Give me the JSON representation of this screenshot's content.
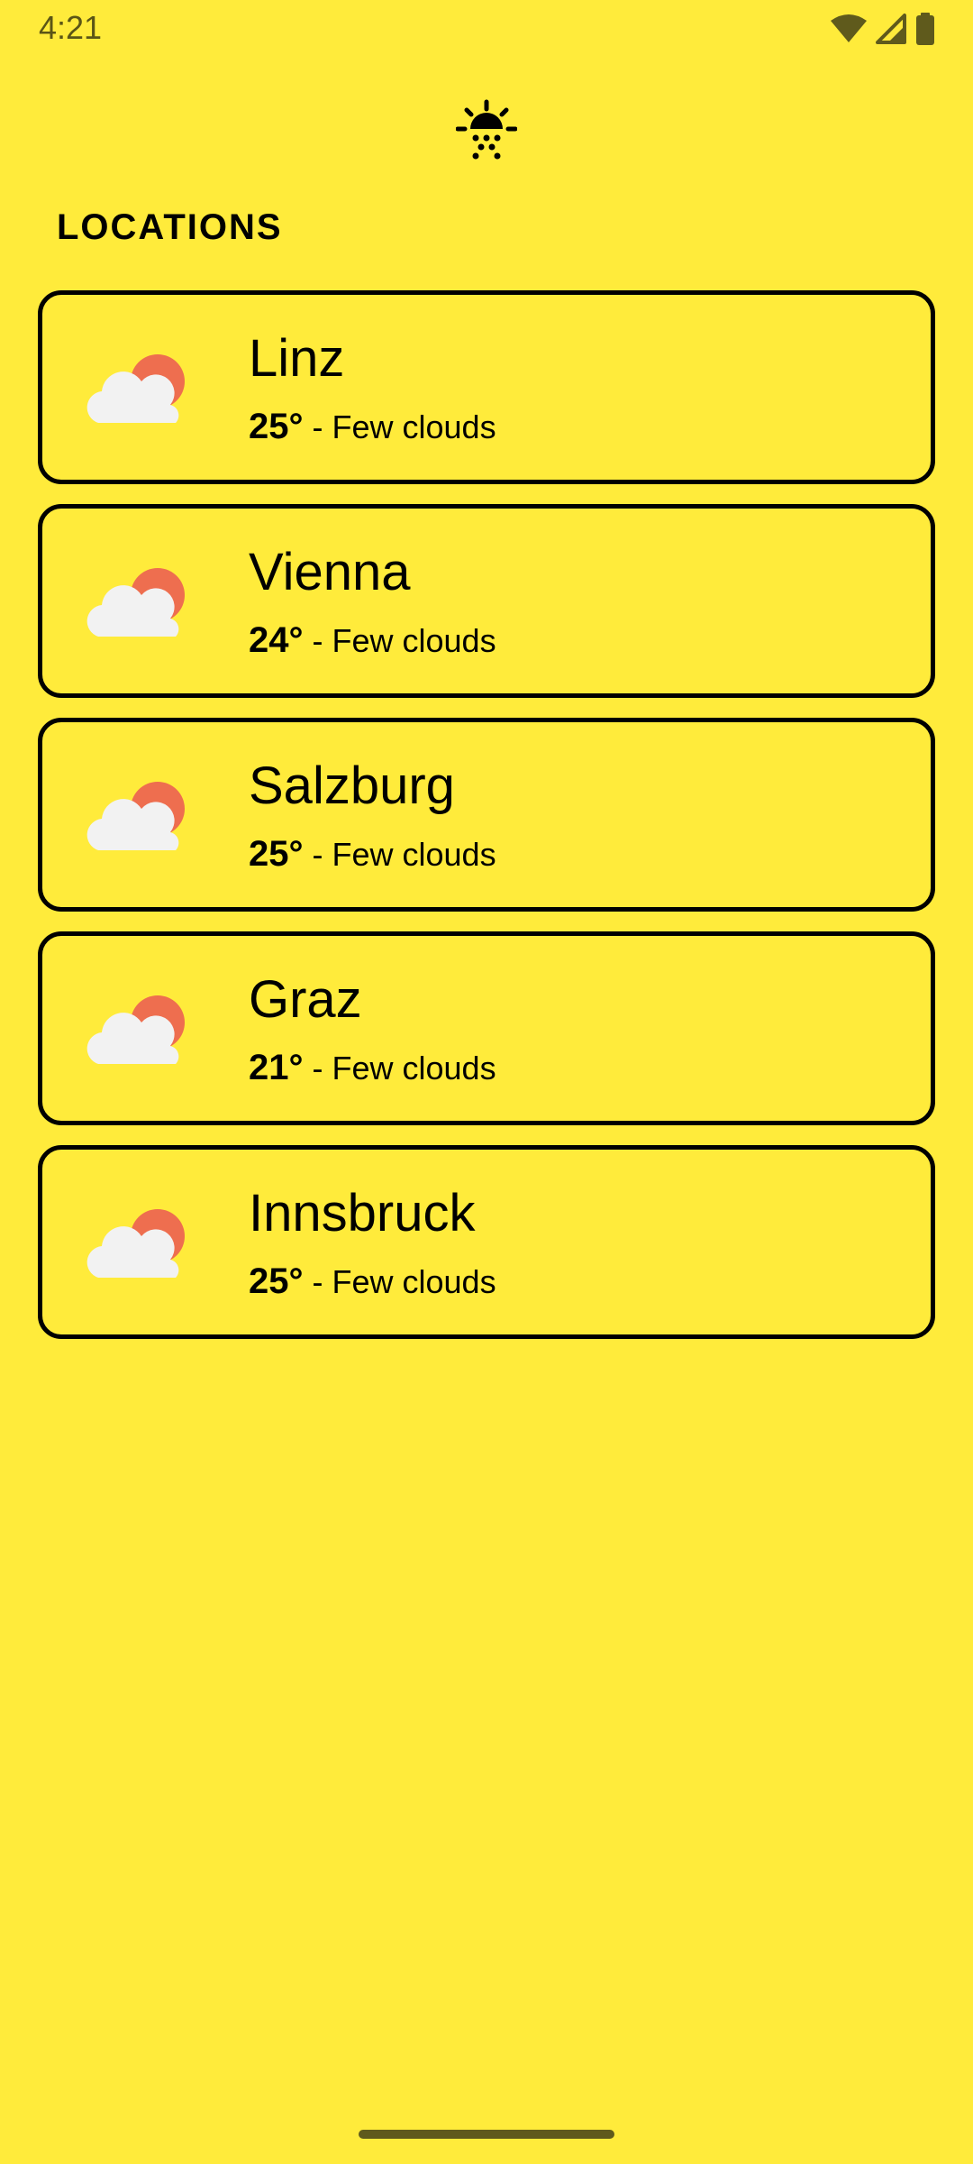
{
  "status_bar": {
    "time": "4:21",
    "icons": [
      "wifi-icon",
      "cellular-signal-icon",
      "battery-icon"
    ]
  },
  "header": {
    "logo_icon": "sunset-icon"
  },
  "section": {
    "title": "LOCATIONS"
  },
  "locations": [
    {
      "city": "Linz",
      "temperature": "25°",
      "separator": " - ",
      "condition": "Few clouds",
      "icon": "few-clouds-icon"
    },
    {
      "city": "Vienna",
      "temperature": "24°",
      "separator": " - ",
      "condition": "Few clouds",
      "icon": "few-clouds-icon"
    },
    {
      "city": "Salzburg",
      "temperature": "25°",
      "separator": " - ",
      "condition": "Few clouds",
      "icon": "few-clouds-icon"
    },
    {
      "city": "Graz",
      "temperature": "21°",
      "separator": " - ",
      "condition": "Few clouds",
      "icon": "few-clouds-icon"
    },
    {
      "city": "Innsbruck",
      "temperature": "25°",
      "separator": " - ",
      "condition": "Few clouds",
      "icon": "few-clouds-icon"
    }
  ],
  "colors": {
    "background": "#FFEB3B",
    "card_border": "#000000",
    "sun": "#EE6E4F",
    "cloud": "#F2F2F2",
    "status_icons": "#5F5A1C"
  }
}
